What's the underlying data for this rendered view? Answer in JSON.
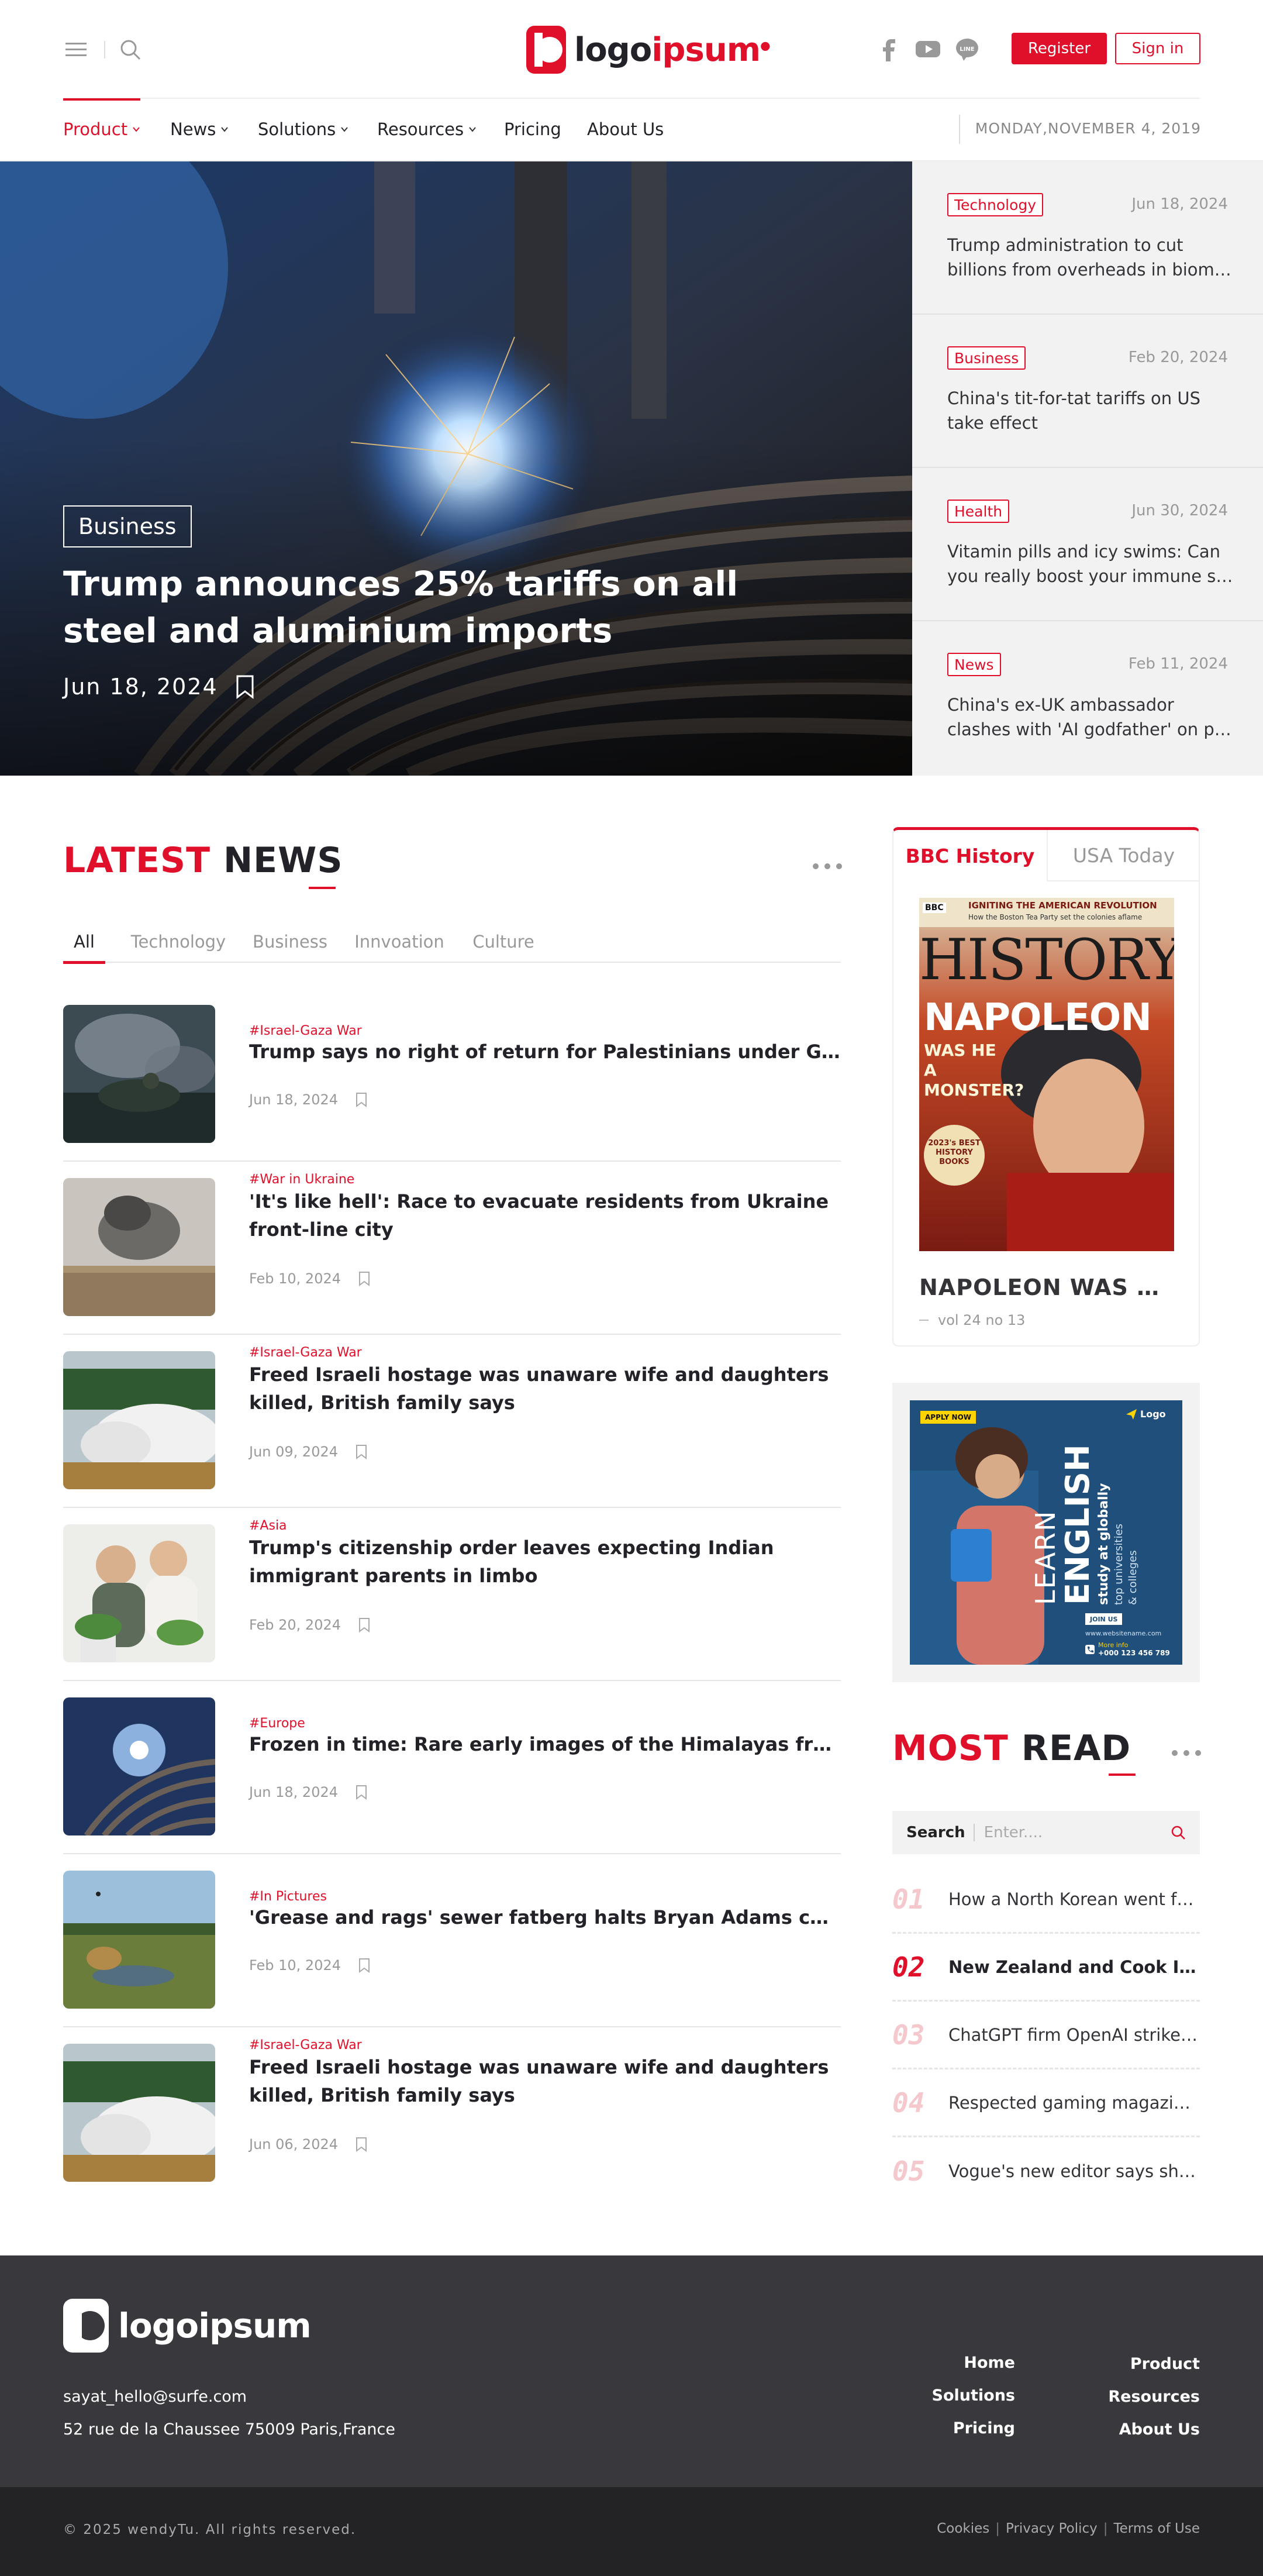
{
  "header": {
    "logo_prefix": "logo",
    "logo_suffix": "ipsum",
    "register_label": "Register",
    "signin_label": "Sign in",
    "date": "MONDAY,NOVEMBER 4, 2019",
    "icons": [
      "menu-icon",
      "search-icon",
      "facebook-icon",
      "youtube-icon",
      "line-icon"
    ]
  },
  "nav": {
    "items": [
      {
        "label": "Product",
        "has_dropdown": true,
        "active": true
      },
      {
        "label": "News",
        "has_dropdown": true
      },
      {
        "label": "Solutions",
        "has_dropdown": true
      },
      {
        "label": "Resources",
        "has_dropdown": true
      },
      {
        "label": "Pricing",
        "has_dropdown": false
      },
      {
        "label": "About Us",
        "has_dropdown": false
      }
    ]
  },
  "hero": {
    "tag": "Business",
    "title": "Trump announces 25% tariffs on all steel and aluminium imports",
    "date": "Jun 18, 2024"
  },
  "side_stories": [
    {
      "tag": "Technology",
      "date": "Jun 18, 2024",
      "title_line1": "Trump administration to cut",
      "title_line2": "billions from overheads in biomedical research"
    },
    {
      "tag": "Business",
      "date": "Feb 20, 2024",
      "title_line1": "China's tit-for-tat tariffs on US",
      "title_line2": "take effect"
    },
    {
      "tag": "Health",
      "date": "Jun 30, 2024",
      "title_line1": "Vitamin pills and icy swims: Can",
      "title_line2": "you really boost your immune system?"
    },
    {
      "tag": "News",
      "date": "Feb 11, 2024",
      "title_line1": "China's ex-UK ambassador",
      "title_line2": "clashes with 'AI godfather' on panel"
    }
  ],
  "latest": {
    "title_red": "LATEST",
    "title_dark": "NEWS",
    "tabs": [
      "All",
      "Technology",
      "Business",
      "Innvoation",
      "Culture"
    ],
    "items": [
      {
        "category": "#Israel-Gaza War",
        "title": "Trump says no right of return for Palestinians under Gaza plan",
        "date": "Jun 18, 2024"
      },
      {
        "category": "#War in Ukraine",
        "title": "'It's like hell': Race to evacuate residents from Ukraine front-line city",
        "date": "Feb 10, 2024"
      },
      {
        "category": "#Israel-Gaza War",
        "title": "Freed Israeli hostage was unaware wife and daughters killed, British family says",
        "date": "Jun 09, 2024"
      },
      {
        "category": "#Asia",
        "title": "Trump's citizenship order leaves expecting Indian immigrant parents in limbo",
        "date": "Feb 20, 2024"
      },
      {
        "category": "#Europe",
        "title": "Frozen in time: Rare early images of the Himalayas from Italian explorers",
        "date": "Jun 18, 2024"
      },
      {
        "category": "#In Pictures",
        "title": "'Grease and rags' sewer fatberg halts Bryan Adams concert",
        "date": "Feb 10, 2024"
      },
      {
        "category": "#Israel-Gaza War",
        "title": "Freed Israeli hostage was unaware wife and daughters killed, British family says",
        "date": "Jun 06, 2024"
      }
    ]
  },
  "magazine": {
    "tab_active": "BBC History",
    "tab_inactive": "USA Today",
    "cover": {
      "brand": "BBC",
      "banner_line1": "IGNITING THE AMERICAN REVOLUTION",
      "banner_line2": "How the Boston Tea Party set the colonies aflame",
      "masthead": "HISTORY",
      "headline": "NAPOLEON",
      "subhead": "WAS HE A MONSTER?",
      "badge": "2023's BEST HISTORY BOOKS"
    },
    "title": "NAPOLEON WAS HE A MONSTER?",
    "volume": "vol 24 no 13"
  },
  "ad": {
    "badge": "APPLY NOW",
    "brand": "Logo",
    "line1": "LEARN",
    "line2": "ENGLISH",
    "line3": "study at globally",
    "line4": "top universities",
    "line5": "& colleges",
    "cta": "JOIN US",
    "website": "www.websitename.com",
    "phone_label": "More info",
    "phone": "+000 123 456 789"
  },
  "most_read": {
    "title_red": "MOST",
    "title_dark": "READ",
    "search_label": "Search",
    "search_placeholder": "Enter....",
    "items": [
      {
        "num": "01",
        "text": "How a North Korean went from soldier to prisoner"
      },
      {
        "num": "02",
        "text": "New Zealand and Cook Islands in talks"
      },
      {
        "num": "03",
        "text": "ChatGPT firm OpenAI strikes new deal"
      },
      {
        "num": "04",
        "text": "Respected gaming magazine closes"
      },
      {
        "num": "05",
        "text": "Vogue's new editor says she will change"
      }
    ]
  },
  "footer": {
    "logo_text": "logoipsum",
    "email": "sayat_hello@surfe.com",
    "address": "52 rue de la Chaussee 75009 Paris,France",
    "links_col1": [
      "Home",
      "Solutions",
      "Pricing"
    ],
    "links_col2": [
      "Product",
      "Resources",
      "About Us"
    ],
    "copyright": "© 2025  wendyTu. All rights reserved.",
    "legal": [
      "Cookies",
      "Privacy Policy",
      "Terms of Use"
    ]
  },
  "colors": {
    "accent": "#e0102b",
    "footer_bg": "#38383d",
    "bottom_bar": "#232326",
    "side_bg": "#f2f2f2"
  }
}
